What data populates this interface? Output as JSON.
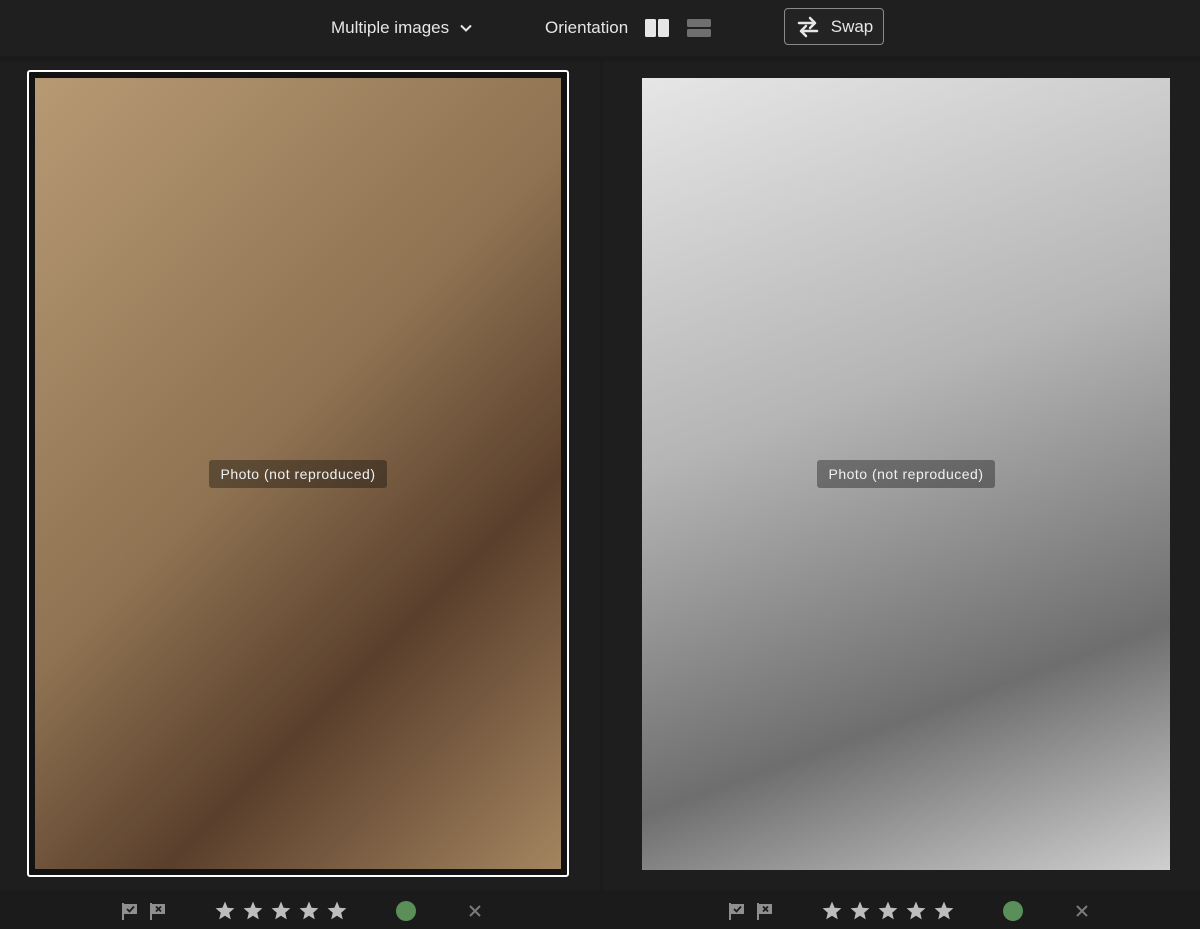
{
  "toolbar": {
    "mode_label": "Multiple images",
    "orientation_label": "Orientation",
    "swap_label": "Swap"
  },
  "images": {
    "left": {
      "placeholder": "Photo (not reproduced)",
      "selected": true
    },
    "right": {
      "placeholder": "Photo (not reproduced)",
      "selected": false
    }
  },
  "ratings": {
    "left": {
      "stars": 0,
      "star_count": 5,
      "color_label": "#5a8f5a"
    },
    "right": {
      "stars": 0,
      "star_count": 5,
      "color_label": "#5a8f5a"
    }
  },
  "colors": {
    "background": "#1b1b1b",
    "selection_border": "#ffffff",
    "icon": "#bdbdbd",
    "color_label_green": "#5a8f5a"
  },
  "icons": {
    "mode_chevron": "chevron-down-icon",
    "side_by_side": "side-by-side-layout-icon",
    "stacked": "stacked-layout-icon",
    "swap": "swap-arrows-icon",
    "pick_flag": "pick-flag-icon",
    "reject_flag": "reject-flag-icon",
    "star": "star-icon",
    "color_label": "color-label-dot",
    "clear": "clear-x-icon"
  }
}
